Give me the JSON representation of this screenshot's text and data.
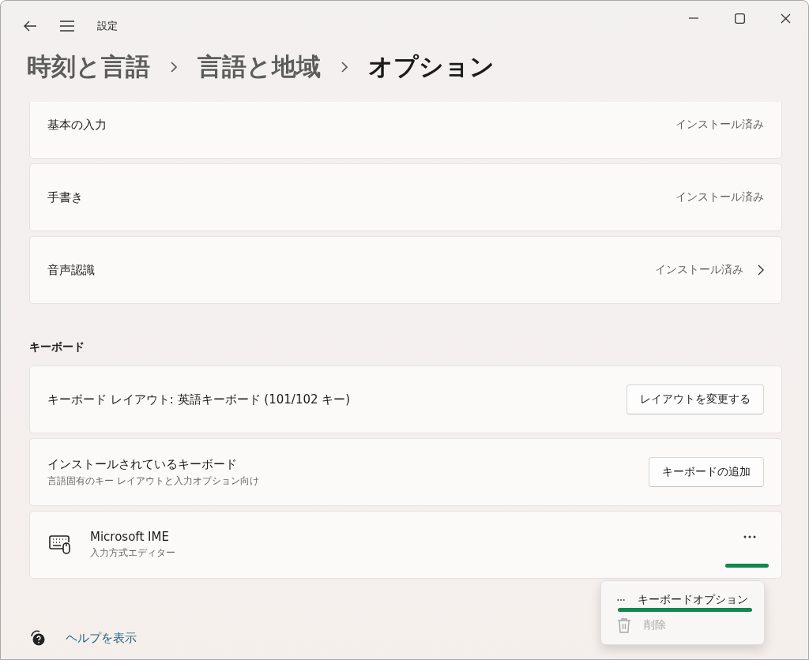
{
  "window": {
    "title": "設定"
  },
  "breadcrumb": [
    {
      "label": "時刻と言語",
      "current": false
    },
    {
      "label": "言語と地域",
      "current": false
    },
    {
      "label": "オプション",
      "current": true
    }
  ],
  "features": [
    {
      "label": "基本の入力",
      "status": "インストール済み",
      "chevron": false
    },
    {
      "label": "手書き",
      "status": "インストール済み",
      "chevron": false
    },
    {
      "label": "音声認識",
      "status": "インストール済み",
      "chevron": true
    }
  ],
  "keyboard_section": {
    "heading": "キーボード",
    "rows": [
      {
        "kind": "button",
        "title": "キーボード レイアウト: 英語キーボード (101/102 キー)",
        "button": "レイアウトを変更する"
      },
      {
        "kind": "button",
        "title": "インストールされているキーボード",
        "subtitle": "言語固有のキー レイアウトと入力オプション向け",
        "button": "キーボードの追加"
      },
      {
        "kind": "keyboard",
        "title": "Microsoft IME",
        "subtitle": "入力方式エディター"
      }
    ]
  },
  "context_menu": {
    "items": [
      {
        "kind": "options",
        "label": "キーボードオプション",
        "disabled": false
      },
      {
        "kind": "delete",
        "label": "削除",
        "disabled": true
      }
    ]
  },
  "help_link": "ヘルプを表示"
}
